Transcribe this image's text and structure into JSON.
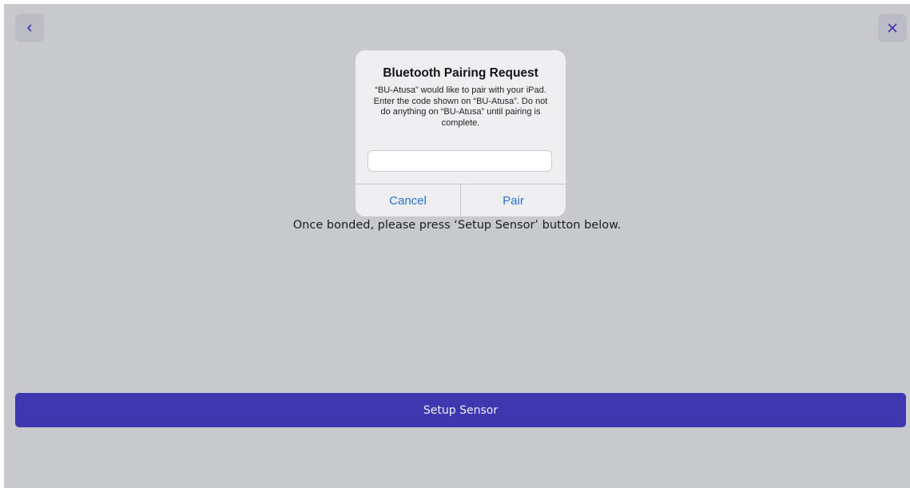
{
  "nav": {
    "back_icon": "chevron-left-icon",
    "close_icon": "close-icon"
  },
  "main": {
    "instruction": "Once bonded, please press ‘Setup Sensor’ button below.",
    "setup_button_label": "Setup Sensor"
  },
  "dialog": {
    "title": "Bluetooth Pairing Request",
    "message": "“BU-Atusa” would like to pair with your iPad. Enter the code shown on “BU-Atusa”. Do not do anything on “BU-Atusa” until pairing is complete.",
    "input_value": "",
    "cancel_label": "Cancel",
    "pair_label": "Pair"
  },
  "colors": {
    "accent": "#3e37b0",
    "background": "#c8c9cd",
    "dialog_action": "#2a6fd6"
  }
}
